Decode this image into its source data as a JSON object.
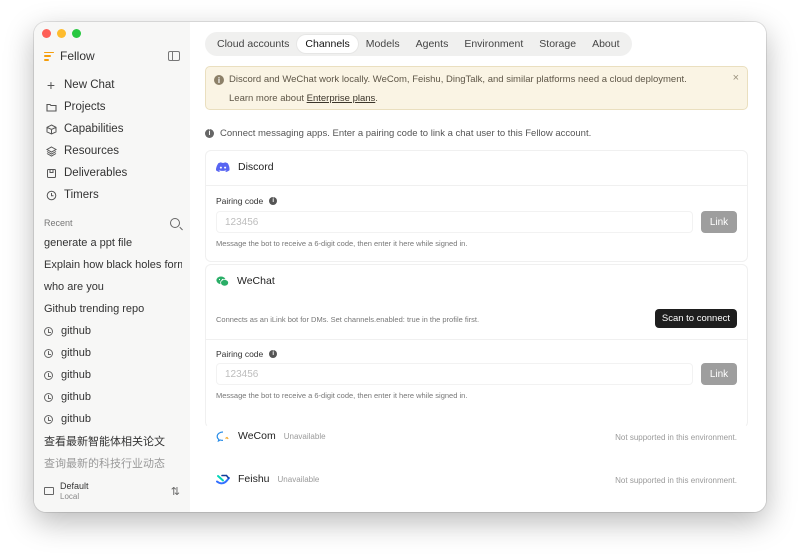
{
  "app": {
    "name": "Fellow"
  },
  "sidebar": {
    "nav": [
      {
        "label": "New Chat",
        "icon": "plus-icon"
      },
      {
        "label": "Projects",
        "icon": "folder-icon"
      },
      {
        "label": "Capabilities",
        "icon": "cube-icon"
      },
      {
        "label": "Resources",
        "icon": "layers-icon"
      },
      {
        "label": "Deliverables",
        "icon": "package-icon"
      },
      {
        "label": "Timers",
        "icon": "clock-icon"
      }
    ],
    "recent_label": "Recent",
    "recent": [
      {
        "label": "generate a ppt file"
      },
      {
        "label": "Explain how black holes form..."
      },
      {
        "label": "who are you"
      },
      {
        "label": "Github trending repo"
      },
      {
        "label": "github"
      },
      {
        "label": "github"
      },
      {
        "label": "github"
      },
      {
        "label": "github"
      },
      {
        "label": "github"
      },
      {
        "label": "查看最新智能体相关论文"
      },
      {
        "label": "查询最新的科技行业动态"
      }
    ],
    "profile": {
      "name": "Default",
      "sub": "Local"
    }
  },
  "tabs": [
    {
      "label": "Cloud accounts"
    },
    {
      "label": "Channels",
      "active": true
    },
    {
      "label": "Models"
    },
    {
      "label": "Agents"
    },
    {
      "label": "Environment"
    },
    {
      "label": "Storage"
    },
    {
      "label": "About"
    }
  ],
  "notice": {
    "text": "Discord and WeChat work locally. WeCom, Feishu, DingTalk, and similar platforms need a cloud deployment.",
    "learn_prefix": "Learn more about ",
    "learn_link": "Enterprise plans",
    "learn_suffix": ".",
    "close": "×"
  },
  "hint": "Connect messaging apps. Enter a pairing code to link a chat user to this Fellow account.",
  "channels": {
    "discord": {
      "name": "Discord",
      "pairing_label": "Pairing code",
      "placeholder": "123456",
      "link_label": "Link",
      "help": "Message the bot to receive a 6-digit code, then enter it here while signed in."
    },
    "wechat": {
      "name": "WeChat",
      "description": "Connects as an iLink bot for DMs. Set channels.enabled: true in the profile first.",
      "scan_label": "Scan to connect",
      "pairing_label": "Pairing code",
      "placeholder": "123456",
      "link_label": "Link",
      "help": "Message the bot to receive a 6-digit code, then enter it here while signed in."
    },
    "wecom": {
      "name": "WeCom",
      "status": "Unavailable",
      "note": "Not supported in this environment."
    },
    "feishu": {
      "name": "Feishu",
      "status": "Unavailable",
      "note": "Not supported in this environment."
    }
  },
  "colors": {
    "discord": "#5865f2",
    "wechat": "#2aae67",
    "accent": "#f59e0b"
  }
}
